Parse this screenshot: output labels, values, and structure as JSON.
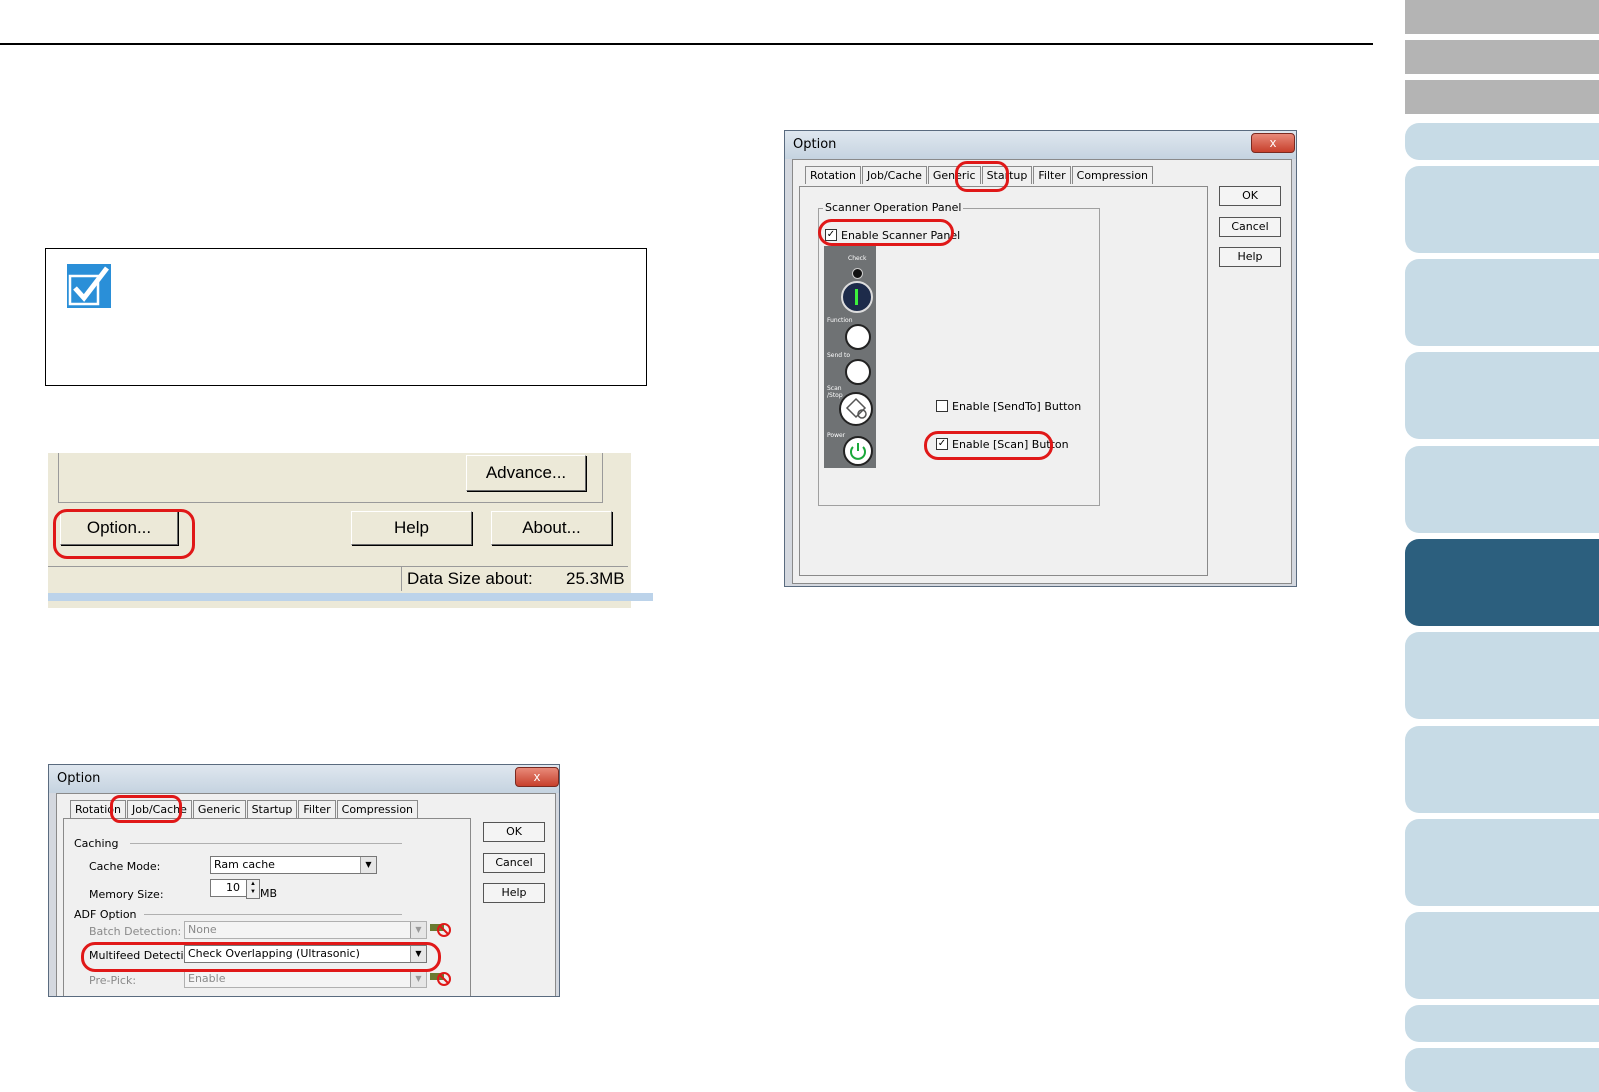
{
  "nav": {
    "colors": {
      "grey": "#b4b4b4",
      "light": "#c7dbe6",
      "active": "#2c5f7e"
    }
  },
  "screenshot1": {
    "advance_label": "Advance...",
    "option_label": "Option...",
    "help_label": "Help",
    "about_label": "About...",
    "status_label": "Data Size about:",
    "status_value": "25.3MB"
  },
  "dialog_jobcache": {
    "title": "Option",
    "close_glyph": "x",
    "tabs": [
      "Rotation",
      "Job/Cache",
      "Generic",
      "Startup",
      "Filter",
      "Compression"
    ],
    "buttons": {
      "ok": "OK",
      "cancel": "Cancel",
      "help": "Help"
    },
    "caching_label": "Caching",
    "cache_mode_label": "Cache Mode:",
    "cache_mode_value": "Ram cache",
    "memory_size_label": "Memory Size:",
    "memory_size_value": "10",
    "memory_size_unit": "MB",
    "adf_option_label": "ADF Option",
    "batch_detection_label": "Batch Detection:",
    "batch_detection_value": "None",
    "multifeed_label": "Multifeed Detection:",
    "multifeed_value": "Check Overlapping (Ultrasonic)",
    "prepick_label": "Pre-Pick:",
    "prepick_value": "Enable"
  },
  "dialog_startup": {
    "title": "Option",
    "close_glyph": "x",
    "tabs": [
      "Rotation",
      "Job/Cache",
      "Generic",
      "Startup",
      "Filter",
      "Compression"
    ],
    "buttons": {
      "ok": "OK",
      "cancel": "Cancel",
      "help": "Help"
    },
    "group_label": "Scanner Operation Panel",
    "enable_panel_label": "Enable Scanner Panel",
    "enable_panel_checked": true,
    "enable_sendto_label": "Enable [SendTo] Button",
    "enable_sendto_checked": false,
    "enable_scan_label": "Enable [Scan] Button",
    "enable_scan_checked": true,
    "panel_labels": {
      "check": "Check",
      "function": "Function",
      "sendto": "Send to",
      "scan": "Scan /Stop",
      "power": "Power"
    }
  },
  "colors": {
    "highlight": "#e01818"
  }
}
